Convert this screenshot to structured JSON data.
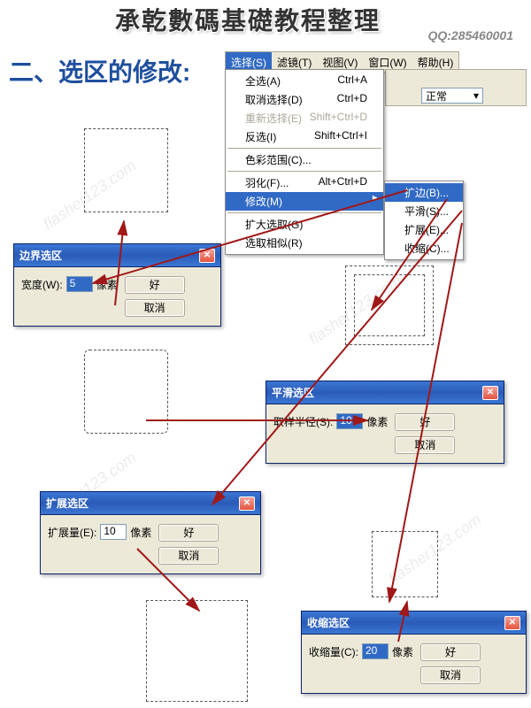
{
  "watermark": {
    "title": "承乾數碼基礎教程整理",
    "qq": "QQ:285460001",
    "faint": "flasher123.com"
  },
  "heading": "二、选区的修改:",
  "menubar": [
    {
      "label": "选择(S)",
      "active": true
    },
    {
      "label": "滤镜(T)",
      "active": false
    },
    {
      "label": "视图(V)",
      "active": false
    },
    {
      "label": "窗口(W)",
      "active": false
    },
    {
      "label": "帮助(H)",
      "active": false
    }
  ],
  "toolbar_select_value": "正常",
  "dropdown": [
    {
      "label": "全选(A)",
      "shortcut": "Ctrl+A",
      "type": "item"
    },
    {
      "label": "取消选择(D)",
      "shortcut": "Ctrl+D",
      "type": "item"
    },
    {
      "label": "重新选择(E)",
      "shortcut": "Shift+Ctrl+D",
      "type": "disabled"
    },
    {
      "label": "反选(I)",
      "shortcut": "Shift+Ctrl+I",
      "type": "item"
    },
    {
      "type": "sep"
    },
    {
      "label": "色彩范围(C)...",
      "shortcut": "",
      "type": "item"
    },
    {
      "type": "sep"
    },
    {
      "label": "羽化(F)...",
      "shortcut": "Alt+Ctrl+D",
      "type": "item"
    },
    {
      "label": "修改(M)",
      "shortcut": "",
      "type": "highlight",
      "arrow": true
    },
    {
      "type": "sep"
    },
    {
      "label": "扩大选取(G)",
      "shortcut": "",
      "type": "item"
    },
    {
      "label": "选取相似(R)",
      "shortcut": "",
      "type": "item"
    }
  ],
  "submenu": [
    {
      "label": "扩边(B)...",
      "highlight": true
    },
    {
      "label": "平滑(S)...",
      "highlight": false
    },
    {
      "label": "扩展(E)...",
      "highlight": false
    },
    {
      "label": "收缩(C)...",
      "highlight": false
    }
  ],
  "dialogs": {
    "border": {
      "title": "边界选区",
      "label": "宽度(W):",
      "value": "5",
      "unit": "像素",
      "ok": "好",
      "cancel": "取消"
    },
    "smooth": {
      "title": "平滑选区",
      "label": "取样半径(S):",
      "value": "10",
      "unit": "像素",
      "ok": "好",
      "cancel": "取消"
    },
    "expand": {
      "title": "扩展选区",
      "label": "扩展量(E):",
      "value": "10",
      "unit": "像素",
      "ok": "好",
      "cancel": "取消"
    },
    "contract": {
      "title": "收缩选区",
      "label": "收缩量(C):",
      "value": "20",
      "unit": "像素",
      "ok": "好",
      "cancel": "取消"
    }
  }
}
